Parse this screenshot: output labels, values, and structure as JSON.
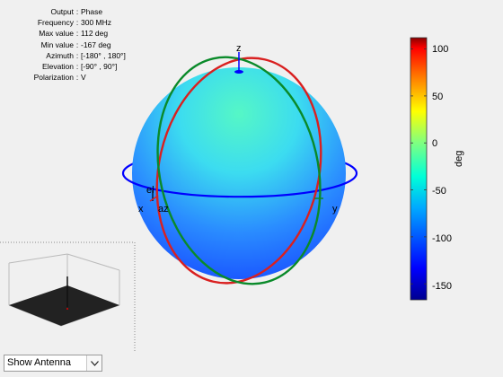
{
  "info": {
    "rows": [
      {
        "key": "Output",
        "value": "Phase"
      },
      {
        "key": "Frequency",
        "value": "300 MHz"
      },
      {
        "key": "Max value",
        "value": "112 deg"
      },
      {
        "key": "Min value",
        "value": "-167 deg"
      },
      {
        "key": "Azimuth",
        "value": "[-180° , 180°]"
      },
      {
        "key": "Elevation",
        "value": "[-90° , 90°]"
      },
      {
        "key": "Polarization",
        "value": "V"
      }
    ],
    "separator": ":"
  },
  "axes": {
    "x": "x",
    "y": "y",
    "z": "z",
    "el": "el",
    "az": "az"
  },
  "colorbar": {
    "ticks": [
      "100",
      "50",
      "0",
      "-50",
      "-100",
      "-150"
    ],
    "tick_values": [
      100,
      50,
      0,
      -50,
      -100,
      -150
    ],
    "min": -167,
    "max": 112,
    "label": "deg"
  },
  "dropdown": {
    "selected": "Show Antenna"
  },
  "colors": {
    "azimuth_ring": "#0000ff",
    "xz_ring": "#d92020",
    "yz_ring": "#0a8a2a",
    "sphere_top": "#4cf0c8",
    "sphere_bottom": "#1a66ff"
  },
  "icons": {
    "dropdown_arrow": "chevron-down-icon"
  }
}
